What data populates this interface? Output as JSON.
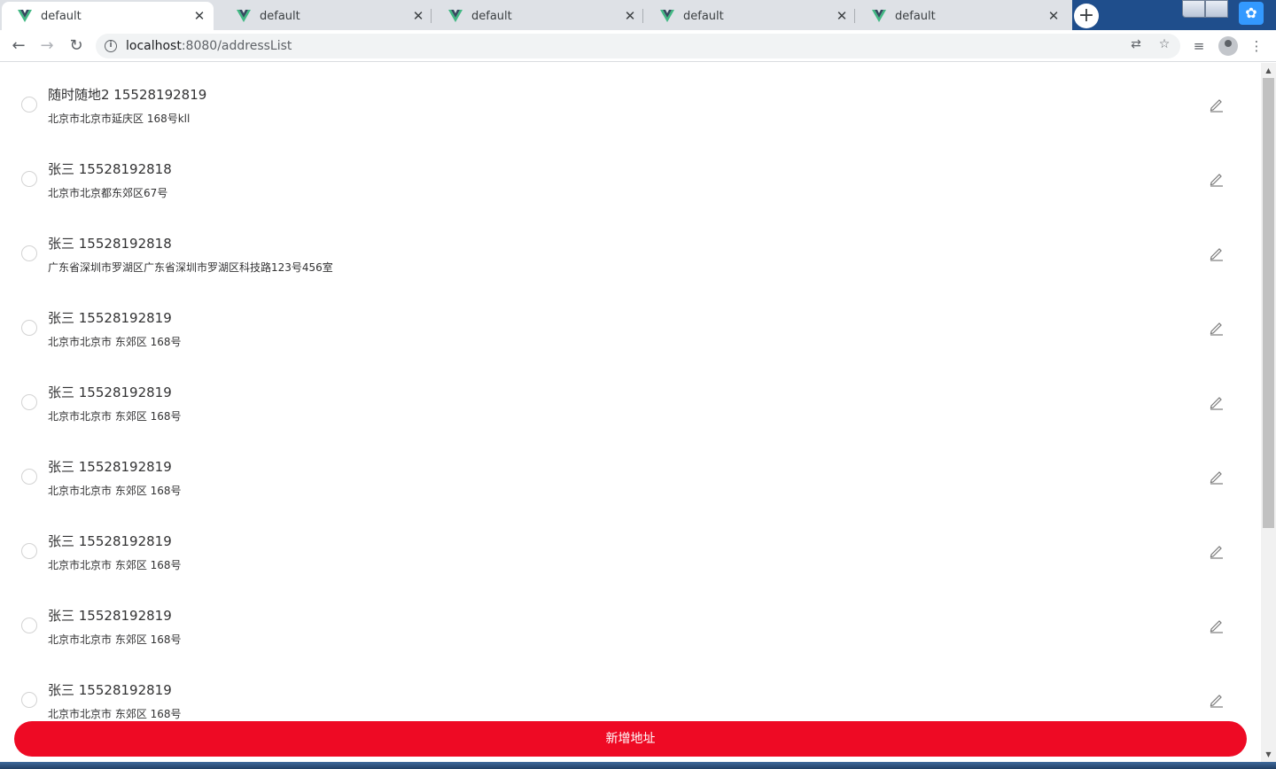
{
  "browser": {
    "tabs": [
      {
        "title": "default",
        "active": true
      },
      {
        "title": "default",
        "active": false
      },
      {
        "title": "default",
        "active": false
      },
      {
        "title": "default",
        "active": false
      },
      {
        "title": "default",
        "active": false
      }
    ],
    "url_host": "localhost",
    "url_path": ":8080/addressList",
    "new_tab_label": "+",
    "close_label": "✕"
  },
  "addresses": [
    {
      "name_phone": "随时随地2 15528192819",
      "detail": "北京市北京市延庆区 168号kll"
    },
    {
      "name_phone": "张三 15528192818",
      "detail": "北京市北京都东郊区67号"
    },
    {
      "name_phone": "张三 15528192818",
      "detail": "广东省深圳市罗湖区广东省深圳市罗湖区科技路123号456室"
    },
    {
      "name_phone": "张三 15528192819",
      "detail": "北京市北京市 东郊区 168号"
    },
    {
      "name_phone": "张三 15528192819",
      "detail": "北京市北京市 东郊区 168号"
    },
    {
      "name_phone": "张三 15528192819",
      "detail": "北京市北京市 东郊区 168号"
    },
    {
      "name_phone": "张三 15528192819",
      "detail": "北京市北京市 东郊区 168号"
    },
    {
      "name_phone": "张三 15528192819",
      "detail": "北京市北京市 东郊区 168号"
    },
    {
      "name_phone": "张三 15528192819",
      "detail": "北京市北京市 东郊区 168号"
    }
  ],
  "submit_label": "新增地址",
  "colors": {
    "accent": "#ee0a24",
    "tab_strip": "#dee1e6",
    "vue_green": "#41b883",
    "vue_dark": "#35495e"
  }
}
